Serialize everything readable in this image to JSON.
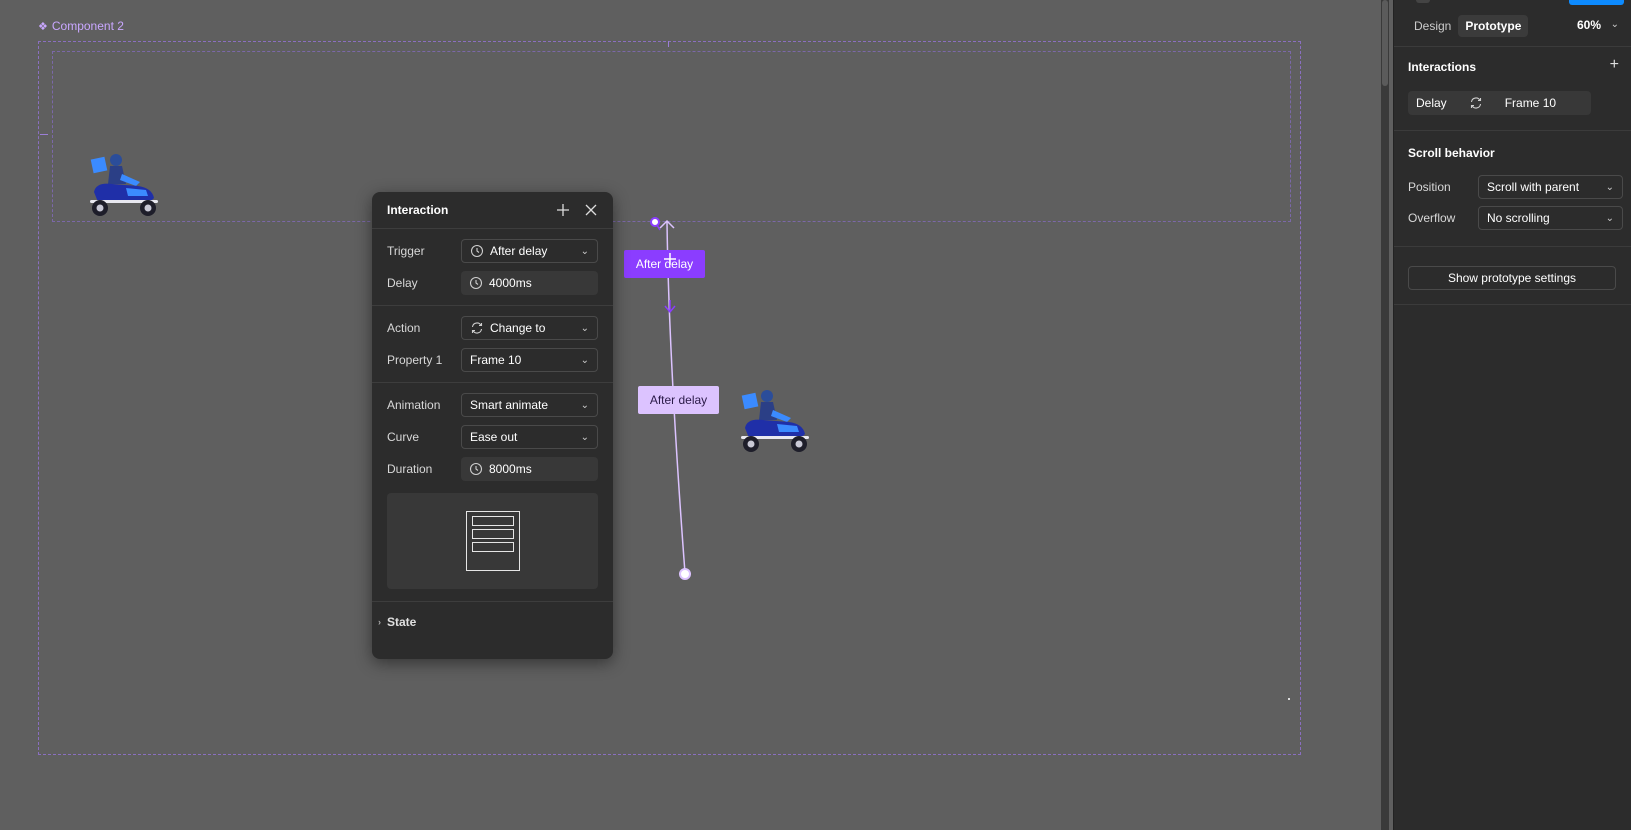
{
  "canvas": {
    "component_label": "Component 2",
    "component_icon": "component-icon"
  },
  "interaction_popover": {
    "title": "Interaction",
    "rows": {
      "trigger": {
        "label": "Trigger",
        "value": "After delay"
      },
      "delay": {
        "label": "Delay",
        "value": "4000ms"
      },
      "action": {
        "label": "Action",
        "value": "Change to"
      },
      "property": {
        "label": "Property 1",
        "value": "Frame 10"
      },
      "animation": {
        "label": "Animation",
        "value": "Smart animate"
      },
      "curve": {
        "label": "Curve",
        "value": "Ease out"
      },
      "duration": {
        "label": "Duration",
        "value": "8000ms"
      }
    },
    "state_label": "State"
  },
  "connector": {
    "active_tag": "After delay",
    "soft_tag": "After delay",
    "accent_color": "#8b3dff",
    "soft_color": "#dcc3ff"
  },
  "panel": {
    "tabs": [
      "Design",
      "Prototype"
    ],
    "active_tab": "Prototype",
    "zoom": "60%",
    "interactions": {
      "title": "Interactions",
      "item": {
        "trigger": "Delay",
        "target": "Frame 10"
      }
    },
    "scroll_behavior": {
      "title": "Scroll behavior",
      "position": {
        "label": "Position",
        "value": "Scroll with parent"
      },
      "overflow": {
        "label": "Overflow",
        "value": "No scrolling"
      }
    },
    "prototype_settings_button": "Show prototype settings"
  }
}
